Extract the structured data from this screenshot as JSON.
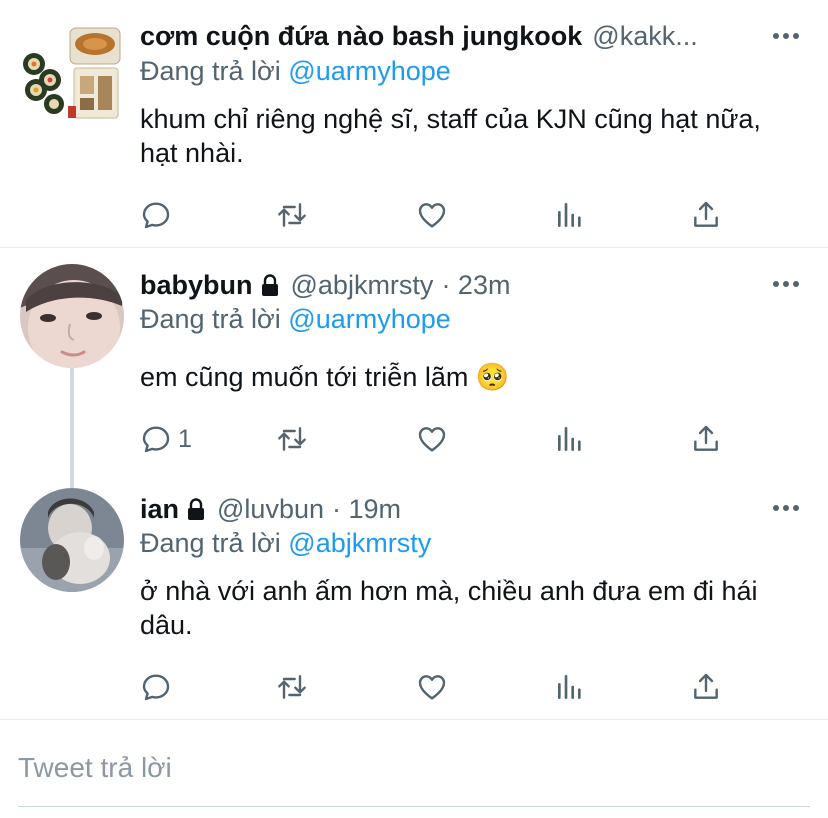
{
  "tweets": [
    {
      "name": "cơm cuộn đứa nào bash jungkook",
      "handle": "@kakk...",
      "time": "",
      "replying_prefix": "Đang trả lời",
      "replying_to": "@uarmyhope",
      "text": "khum chỉ riêng nghệ sĩ, staff của KJN cũng hạt nữa, hạt nhài.",
      "reply_count": ""
    },
    {
      "name": "babybun",
      "handle": "@abjkmrsty",
      "time": "· 23m",
      "replying_prefix": "Đang trả lời",
      "replying_to": "@uarmyhope",
      "text": "em cũng muốn tới triễn lãm 🥺",
      "reply_count": "1"
    },
    {
      "name": "ian",
      "handle": "@luvbun",
      "time": "· 19m",
      "replying_prefix": "Đang trả lời",
      "replying_to": "@abjkmrsty",
      "text": "ở nhà với anh ấm hơn mà, chiều anh đưa em đi hái dâu.",
      "reply_count": ""
    }
  ],
  "composer": {
    "placeholder": "Tweet trả lời"
  },
  "colors": {
    "accent": "#1d9bf0",
    "secondary_text": "#536471",
    "divider": "#e6ecf0"
  },
  "icons": [
    "reply-icon",
    "retweet-icon",
    "like-icon",
    "analytics-icon",
    "share-icon",
    "more-icon",
    "lock-icon"
  ]
}
